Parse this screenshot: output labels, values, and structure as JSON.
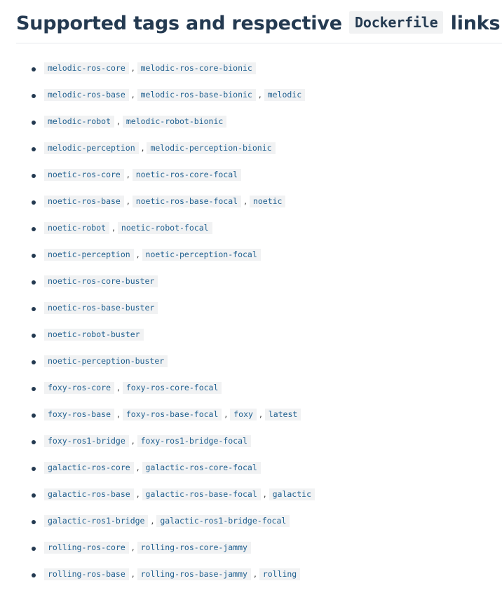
{
  "heading": {
    "prefix": "Supported tags and respective",
    "code": "Dockerfile",
    "suffix": "links"
  },
  "colors": {
    "heading": "#243a51",
    "tag_text": "#1f5f8f",
    "code_background": "#f1f2f3"
  },
  "tag_groups": [
    [
      "melodic-ros-core",
      "melodic-ros-core-bionic"
    ],
    [
      "melodic-ros-base",
      "melodic-ros-base-bionic",
      "melodic"
    ],
    [
      "melodic-robot",
      "melodic-robot-bionic"
    ],
    [
      "melodic-perception",
      "melodic-perception-bionic"
    ],
    [
      "noetic-ros-core",
      "noetic-ros-core-focal"
    ],
    [
      "noetic-ros-base",
      "noetic-ros-base-focal",
      "noetic"
    ],
    [
      "noetic-robot",
      "noetic-robot-focal"
    ],
    [
      "noetic-perception",
      "noetic-perception-focal"
    ],
    [
      "noetic-ros-core-buster"
    ],
    [
      "noetic-ros-base-buster"
    ],
    [
      "noetic-robot-buster"
    ],
    [
      "noetic-perception-buster"
    ],
    [
      "foxy-ros-core",
      "foxy-ros-core-focal"
    ],
    [
      "foxy-ros-base",
      "foxy-ros-base-focal",
      "foxy",
      "latest"
    ],
    [
      "foxy-ros1-bridge",
      "foxy-ros1-bridge-focal"
    ],
    [
      "galactic-ros-core",
      "galactic-ros-core-focal"
    ],
    [
      "galactic-ros-base",
      "galactic-ros-base-focal",
      "galactic"
    ],
    [
      "galactic-ros1-bridge",
      "galactic-ros1-bridge-focal"
    ],
    [
      "rolling-ros-core",
      "rolling-ros-core-jammy"
    ],
    [
      "rolling-ros-base",
      "rolling-ros-base-jammy",
      "rolling"
    ]
  ],
  "separator": ","
}
